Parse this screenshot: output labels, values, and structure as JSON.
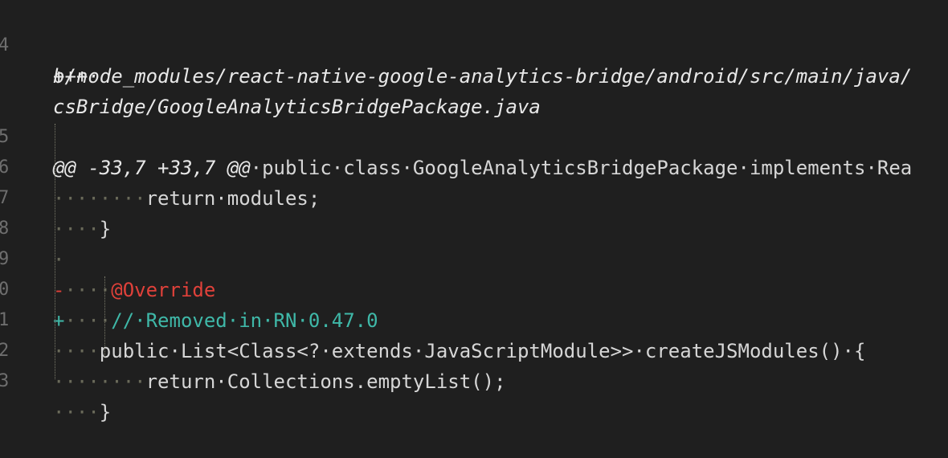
{
  "editor": {
    "lines": [
      {
        "num": "4",
        "text": "+++·"
      },
      {
        "num": "",
        "text": "b/node_modules/react-native-google-analytics-bridge/android/src/main/java/"
      },
      {
        "num": "",
        "text": "csBridge/GoogleAnalyticsBridgePackage.java"
      },
      {
        "num": "5",
        "hunk": "@@ -33,7 +33,7 @@",
        "text": "·public·class·GoogleAnalyticsBridgePackage·implements·Rea"
      },
      {
        "num": "6",
        "indent": "········",
        "text": "return·modules;"
      },
      {
        "num": "7",
        "indent": "····",
        "text": "}"
      },
      {
        "num": "8",
        "indent": "·",
        "text": ""
      },
      {
        "num": "9",
        "marker": "-",
        "indent": "····",
        "text": "@Override"
      },
      {
        "num": "0",
        "marker": "+",
        "indent": "····",
        "text": "//·Removed·in·RN·0.47.0"
      },
      {
        "num": "1",
        "indent": "····",
        "text": "public·List<Class<?·extends·JavaScriptModule>>·createJSModules()·{"
      },
      {
        "num": "2",
        "indent": "········",
        "text": "return·Collections.emptyList();"
      },
      {
        "num": "3",
        "indent": "····",
        "text": "}"
      }
    ]
  }
}
